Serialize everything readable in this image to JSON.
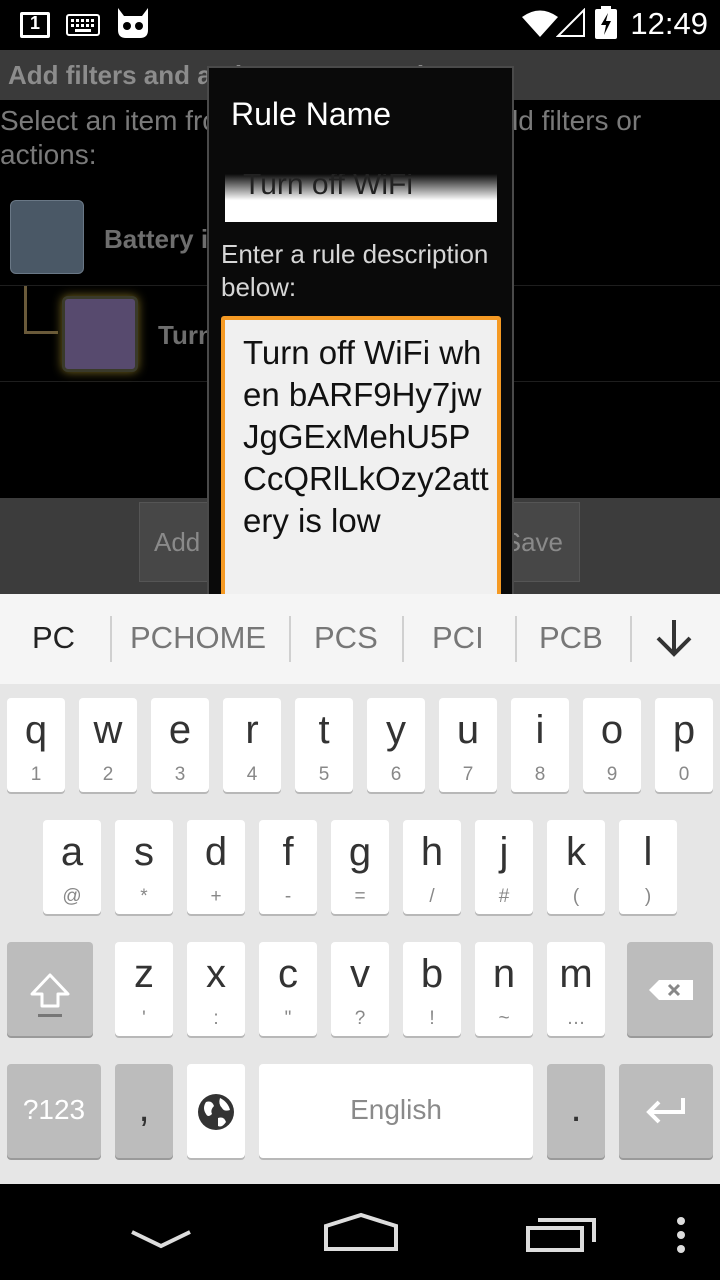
{
  "status_bar": {
    "time": "12:49",
    "notification_count": "1",
    "icons": [
      "notification-count-icon",
      "keyboard-icon",
      "cyanogen-mascot-icon",
      "wifi-icon",
      "signal-icon",
      "battery-charging-icon"
    ]
  },
  "app": {
    "header_title": "Add filters and actions to your rule",
    "hint": "Select an item from the list below, then add filters or actions:",
    "rows": [
      {
        "label": "Battery is low",
        "color": "#4a5866"
      },
      {
        "label": "Turn off WiFi",
        "color": "#574a6e"
      }
    ],
    "add_button": "Add filter",
    "save_button": "Save"
  },
  "dialog": {
    "title": "Rule Name",
    "name_value": "Turn off WiFi",
    "description_label": "Enter a rule description below:",
    "description_value": "Turn off WiFi when bARF9Hy7jwJgGExMehU5PCcQRlLkOzy2attery is low",
    "accent_color": "#f59a24"
  },
  "keyboard": {
    "suggestions": [
      "PC",
      "PCHOME",
      "PCS",
      "PCI",
      "PCB"
    ],
    "row1": [
      {
        "k": "q",
        "s": "1"
      },
      {
        "k": "w",
        "s": "2"
      },
      {
        "k": "e",
        "s": "3"
      },
      {
        "k": "r",
        "s": "4"
      },
      {
        "k": "t",
        "s": "5"
      },
      {
        "k": "y",
        "s": "6"
      },
      {
        "k": "u",
        "s": "7"
      },
      {
        "k": "i",
        "s": "8"
      },
      {
        "k": "o",
        "s": "9"
      },
      {
        "k": "p",
        "s": "0"
      }
    ],
    "row2": [
      {
        "k": "a",
        "s": "@"
      },
      {
        "k": "s",
        "s": "*"
      },
      {
        "k": "d",
        "s": "+"
      },
      {
        "k": "f",
        "s": "-"
      },
      {
        "k": "g",
        "s": "="
      },
      {
        "k": "h",
        "s": "/"
      },
      {
        "k": "j",
        "s": "#"
      },
      {
        "k": "k",
        "s": "("
      },
      {
        "k": "l",
        "s": ")"
      }
    ],
    "row3": [
      {
        "k": "z",
        "s": "'"
      },
      {
        "k": "x",
        "s": ":"
      },
      {
        "k": "c",
        "s": "\""
      },
      {
        "k": "v",
        "s": "?"
      },
      {
        "k": "b",
        "s": "!"
      },
      {
        "k": "n",
        "s": "~"
      },
      {
        "k": "m",
        "s": "…"
      }
    ],
    "symbols_key": "?123",
    "comma_key": ",",
    "space_label": "English",
    "period_key": "."
  },
  "nav_bar": {
    "icons": [
      "back-icon",
      "home-icon",
      "recent-apps-icon",
      "menu-icon"
    ]
  }
}
